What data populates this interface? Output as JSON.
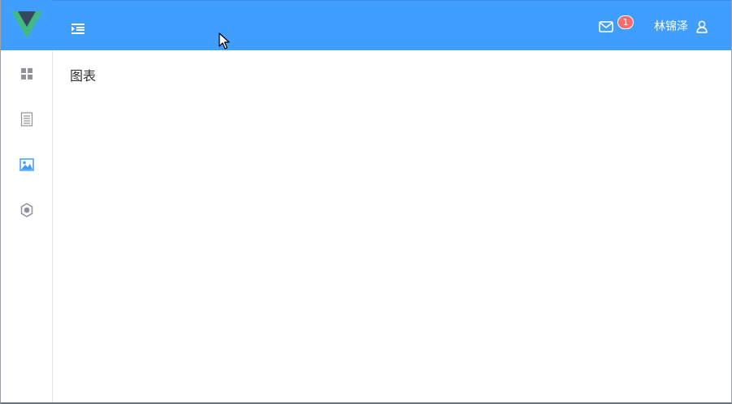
{
  "header": {
    "message_count": "1",
    "username": "林锦泽"
  },
  "sidebar": {
    "items": [
      {
        "icon": "dashboard-icon",
        "active": false
      },
      {
        "icon": "document-icon",
        "active": false
      },
      {
        "icon": "picture-icon",
        "active": true
      },
      {
        "icon": "setting-icon",
        "active": false
      }
    ]
  },
  "main": {
    "title": "图表"
  },
  "colors": {
    "primary": "#409eff",
    "badge": "#f56c6c",
    "icon_inactive": "#909399",
    "text": "#303133"
  }
}
